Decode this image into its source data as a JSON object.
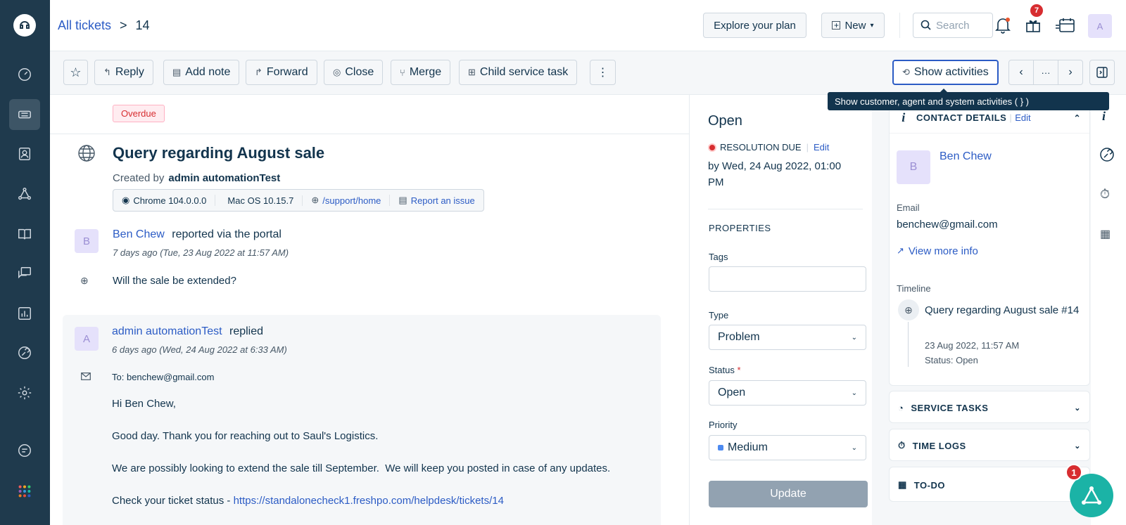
{
  "breadcrumb": {
    "parent": "All tickets",
    "separator": ">",
    "current": "14"
  },
  "topbar": {
    "explore_label": "Explore your plan",
    "new_label": "New",
    "search_placeholder": "Search",
    "gift_badge": "7",
    "avatar_initial": "A"
  },
  "actions": {
    "reply": "Reply",
    "add_note": "Add note",
    "forward": "Forward",
    "close": "Close",
    "merge": "Merge",
    "child_task": "Child service task",
    "more": "⋮",
    "show_activities": "Show activities",
    "nav_more": "···"
  },
  "tooltip": "Show customer, agent and system activities ( } )",
  "ticket": {
    "status_tag": "Overdue",
    "subject": "Query regarding August sale",
    "created_by_label": "Created by",
    "created_by": "admin automationTest",
    "meta": {
      "browser": "Chrome 104.0.0.0",
      "os": "Mac OS 10.15.7",
      "path": "/support/home",
      "report": "Report an issue"
    }
  },
  "messages": [
    {
      "avatar": "B",
      "name": "Ben Chew",
      "action": "reported via the portal",
      "time": "7 days ago (Tue, 23 Aug 2022 at 11:57 AM)",
      "body": "Will the sale be extended?"
    },
    {
      "avatar": "A",
      "name": "admin automationTest",
      "action": "replied",
      "time": "6 days ago (Wed, 24 Aug 2022 at 6:33 AM)",
      "to_label": "To:",
      "to": "benchew@gmail.com",
      "greeting": "Hi Ben Chew,",
      "line1": "Good day. Thank you for reaching out to Saul's Logistics.",
      "line2": "We are possibly looking to extend the sale till September.  We will keep you posted in case of any updates.",
      "line3_prefix": "Check your ticket status - ",
      "line3_link": "https://standalonecheck1.freshpo.com/helpdesk/tickets/14"
    }
  ],
  "properties": {
    "status_heading": "Open",
    "resolution_label": "RESOLUTION DUE",
    "edit": "Edit",
    "due": "by Wed, 24 Aug 2022, 01:00 PM",
    "heading": "PROPERTIES",
    "tags_label": "Tags",
    "type_label": "Type",
    "type_value": "Problem",
    "status_label": "Status",
    "required": "*",
    "status_value": "Open",
    "priority_label": "Priority",
    "priority_value": "Medium",
    "priority_color": "#4d8af0",
    "update_label": "Update"
  },
  "contact": {
    "heading": "CONTACT DETAILS",
    "sep": "|",
    "edit": "Edit",
    "avatar": "B",
    "name": "Ben Chew",
    "email_label": "Email",
    "email": "benchew@gmail.com",
    "view_more": "View more info",
    "timeline_label": "Timeline",
    "timeline_title": "Query regarding August sale #14",
    "timeline_date": "23 Aug 2022, 11:57 AM",
    "timeline_status": "Status: Open"
  },
  "sections": {
    "service_tasks": "SERVICE TASKS",
    "time_logs": "TIME LOGS",
    "todo": "TO-DO"
  },
  "fab_badge": "1",
  "colors": {
    "sidebar": "#1f3a4d",
    "accent": "#2c5cc5",
    "danger": "#d72d30",
    "fab": "#1bb3a6"
  }
}
